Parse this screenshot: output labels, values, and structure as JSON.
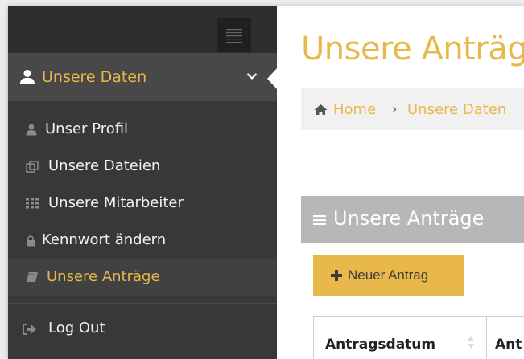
{
  "sidebar": {
    "toggle_icon": "hamburger-icon",
    "section": {
      "label": "Unsere Daten",
      "icon": "user-icon",
      "expand_icon": "chevron-down-icon"
    },
    "items": [
      {
        "label": "Unser Profil",
        "icon": "user-small-icon",
        "active": false
      },
      {
        "label": "Unsere Dateien",
        "icon": "files-icon",
        "active": false
      },
      {
        "label": "Unsere Mitarbeiter",
        "icon": "grid-icon",
        "active": false
      },
      {
        "label": "Kennwort ändern",
        "icon": "lock-icon",
        "active": false
      },
      {
        "label": "Unsere Anträge",
        "icon": "book-icon",
        "active": true
      }
    ],
    "logout": {
      "label": "Log Out",
      "icon": "sign-out-icon"
    }
  },
  "main": {
    "title": "Unsere Anträg",
    "breadcrumb": {
      "home": "Home",
      "separator": "›",
      "current": "Unsere Daten"
    },
    "panel": {
      "title": "Unsere Anträge"
    },
    "new_button": {
      "label": "Neuer Antrag",
      "icon": "plus-icon"
    },
    "table": {
      "columns": [
        "Antragsdatum",
        "Ant"
      ]
    }
  },
  "colors": {
    "accent": "#e9b84a",
    "sidebar": "#383838",
    "sidebar_active": "#484848",
    "panel_header": "#b7b7b7"
  }
}
